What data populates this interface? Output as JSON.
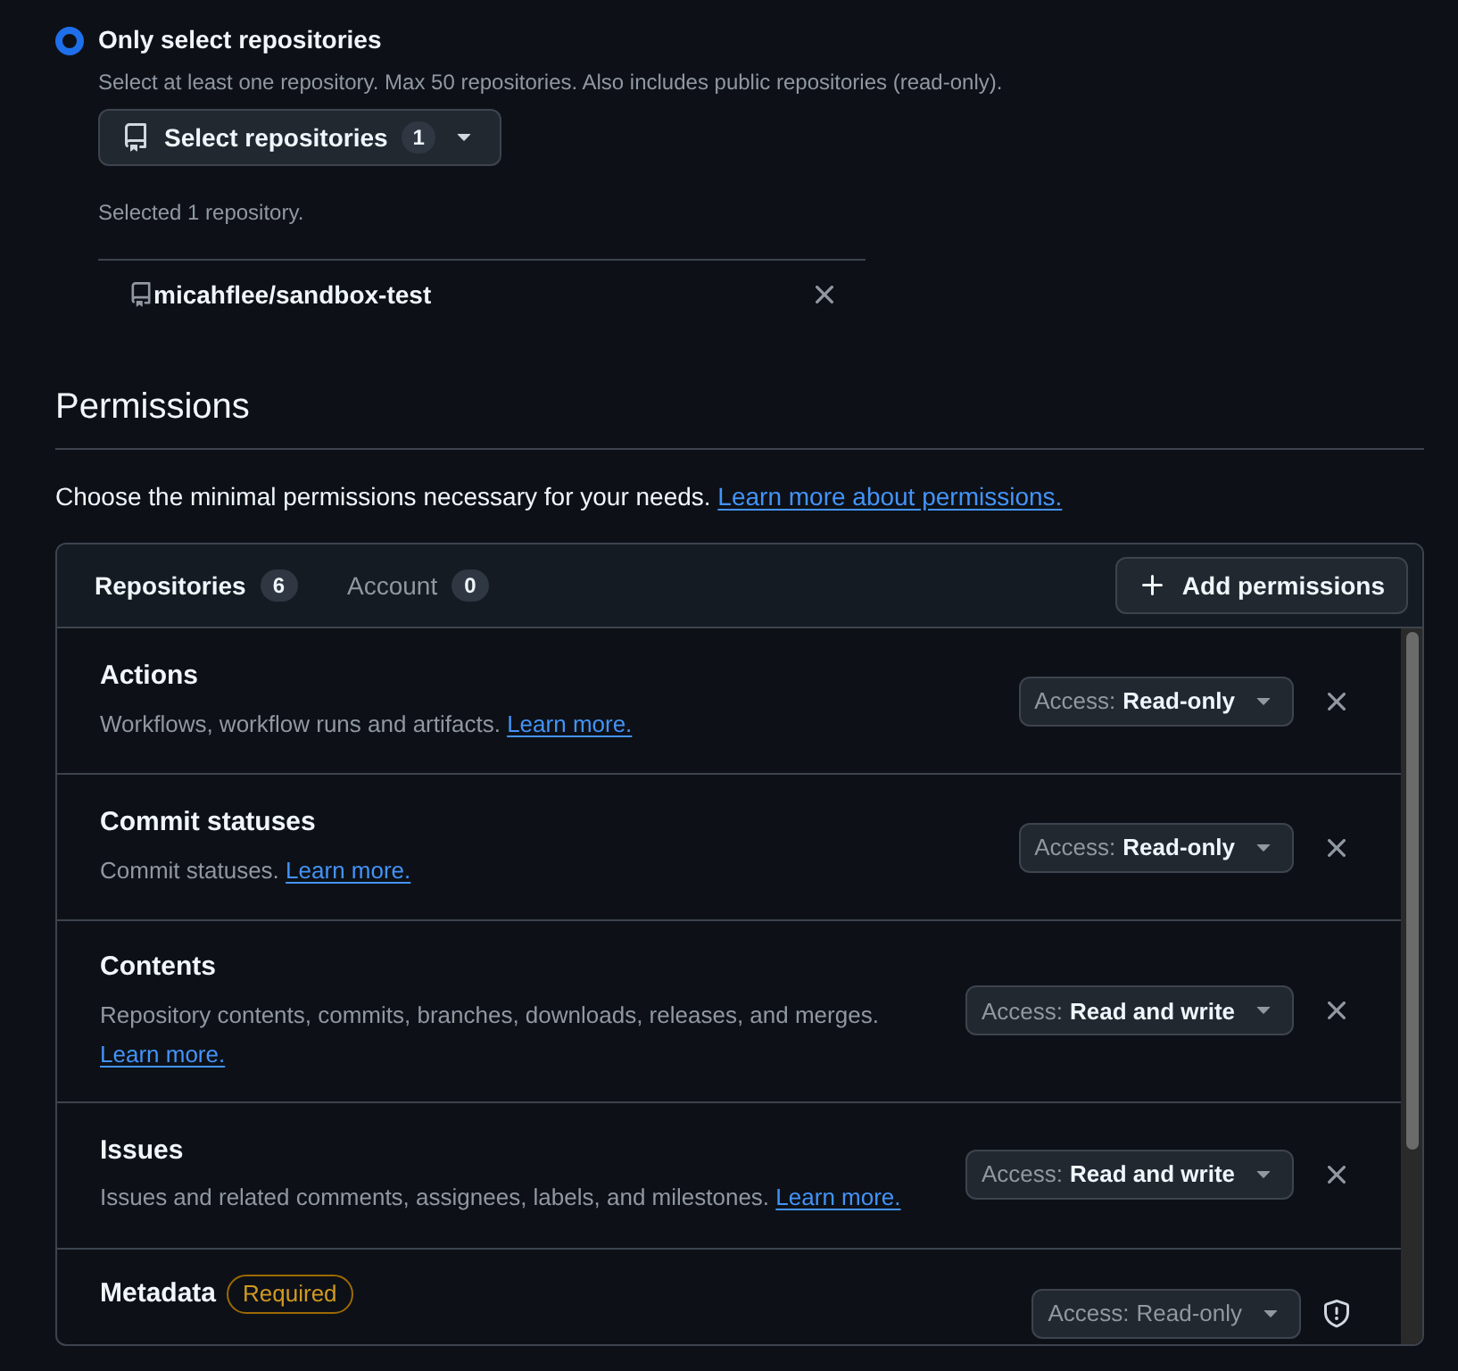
{
  "repository_access": {
    "option": {
      "label": "Only select repositories",
      "selected": true,
      "description": "Select at least one repository. Max 50 repositories. Also includes public repositories (read-only)."
    },
    "select_button": {
      "label": "Select repositories",
      "count": "1"
    },
    "selected_summary": "Selected 1 repository.",
    "selected_repositories": [
      {
        "name": "micahflee/sandbox-test"
      }
    ]
  },
  "permissions": {
    "title": "Permissions",
    "intro": "Choose the minimal permissions necessary for your needs.",
    "intro_link": "Learn more about permissions.",
    "tabs": [
      {
        "label": "Repositories",
        "count": "6",
        "selected": true
      },
      {
        "label": "Account",
        "count": "0",
        "selected": false
      }
    ],
    "add_button": "Add permissions",
    "rows": [
      {
        "kind": "removable",
        "name": "Actions",
        "description": "Workflows, workflow runs and artifacts.",
        "link": "Learn more.",
        "link_wrapped": false,
        "access_label": "Access:",
        "access_value": "Read-only",
        "disabled": false
      },
      {
        "kind": "removable",
        "name": "Commit statuses",
        "description": "Commit statuses.",
        "link": "Learn more.",
        "link_wrapped": false,
        "access_label": "Access:",
        "access_value": "Read-only",
        "disabled": false
      },
      {
        "kind": "removable",
        "name": "Contents",
        "description": "Repository contents, commits, branches, downloads, releases, and merges.",
        "link": "Learn more.",
        "link_wrapped": true,
        "access_label": "Access:",
        "access_value": "Read and write",
        "disabled": false
      },
      {
        "kind": "removable",
        "name": "Issues",
        "description": "Issues and related comments, assignees, labels, and milestones.",
        "link": "Learn more.",
        "link_wrapped": false,
        "access_label": "Access:",
        "access_value": "Read and write",
        "disabled": false
      },
      {
        "kind": "required",
        "name": "Metadata",
        "badge": "Required",
        "access_label": "Access:",
        "access_value": "Read-only",
        "disabled": true
      }
    ]
  }
}
